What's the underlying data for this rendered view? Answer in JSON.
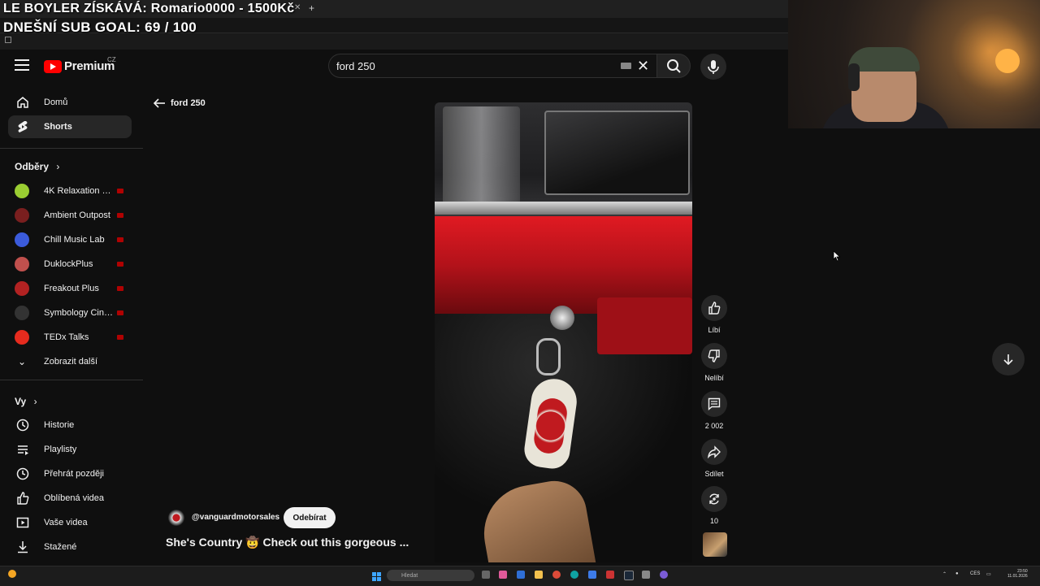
{
  "overlay": {
    "donation_text": "LE BOYLER ZÍSKÁVÁ: Romario0000 - 1500Kč",
    "sub_goal_text": "DNEŠNÍ SUB GOAL: 69 / 100"
  },
  "header": {
    "logo_text": "Premium",
    "logo_region": "CZ",
    "search_value": "ford 250"
  },
  "sidebar": {
    "main": [
      {
        "label": "Domů",
        "icon": "home-icon"
      },
      {
        "label": "Shorts",
        "icon": "shorts-icon"
      }
    ],
    "subscriptions_title": "Odběry",
    "subscriptions": [
      {
        "label": "4K Relaxation Ch...",
        "color": "#9acd32"
      },
      {
        "label": "Ambient Outpost",
        "color": "#7a1f1f"
      },
      {
        "label": "Chill Music Lab",
        "color": "#3b5bdb"
      },
      {
        "label": "DuklockPlus",
        "color": "#c0504d"
      },
      {
        "label": "Freakout Plus",
        "color": "#b22222"
      },
      {
        "label": "Symbology Cine...",
        "color": "#333333"
      },
      {
        "label": "TEDx Talks",
        "color": "#e62b1e"
      }
    ],
    "show_more": "Zobrazit další",
    "you_title": "Vy",
    "you_items": [
      {
        "label": "Historie",
        "icon": "history-icon"
      },
      {
        "label": "Playlisty",
        "icon": "playlists-icon"
      },
      {
        "label": "Přehrát později",
        "icon": "watch-later-icon"
      },
      {
        "label": "Oblíbená videa",
        "icon": "liked-videos-icon"
      },
      {
        "label": "Vaše videa",
        "icon": "your-videos-icon"
      },
      {
        "label": "Stažené",
        "icon": "downloads-icon"
      }
    ]
  },
  "back": {
    "label": "ford 250"
  },
  "short": {
    "channel": "@vanguardmotorsales",
    "subscribe_label": "Odebírat",
    "title": "She's Country 🤠 Check out this gorgeous ..."
  },
  "actions": {
    "like_label": "Líbí",
    "dislike_label": "Nelíbí",
    "comments_count": "2 002",
    "share_label": "Sdílet",
    "remix_count": "10"
  },
  "taskbar": {
    "search_placeholder": "Hledat",
    "lang": "CES",
    "time": "23:50",
    "date": "11.01.2026"
  },
  "colors": {
    "accent": "#ff0000",
    "background": "#0f0f0f",
    "live": "#cc0000"
  }
}
